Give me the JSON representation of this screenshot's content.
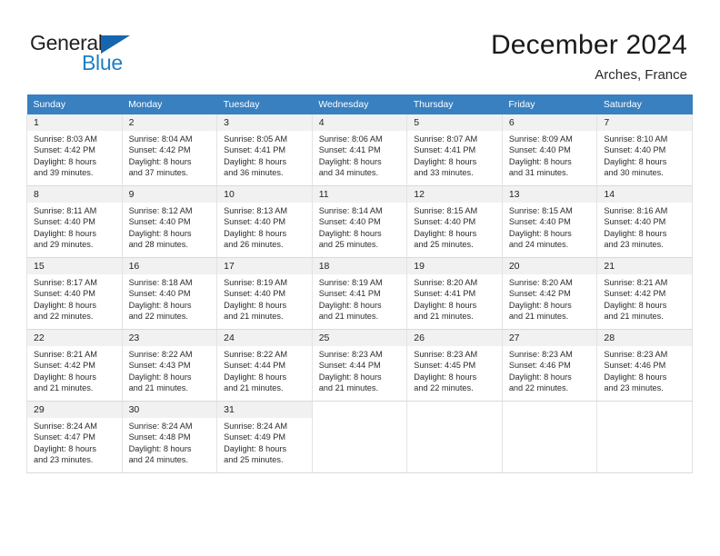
{
  "brand": {
    "name_part1": "General",
    "name_part2": "Blue",
    "triangle_icon": "triangle-icon",
    "color_dark": "#231f20",
    "color_blue": "#1f7ec4"
  },
  "header": {
    "title": "December 2024",
    "location": "Arches, France"
  },
  "theme": {
    "header_row_bg": "#3880c0",
    "daynum_bg": "#f1f1f1",
    "grid_border": "#e3e3e3"
  },
  "weekday_headers": [
    "Sunday",
    "Monday",
    "Tuesday",
    "Wednesday",
    "Thursday",
    "Friday",
    "Saturday"
  ],
  "weeks": [
    [
      {
        "day": "1",
        "sunrise": "Sunrise: 8:03 AM",
        "sunset": "Sunset: 4:42 PM",
        "daylight1": "Daylight: 8 hours",
        "daylight2": "and 39 minutes."
      },
      {
        "day": "2",
        "sunrise": "Sunrise: 8:04 AM",
        "sunset": "Sunset: 4:42 PM",
        "daylight1": "Daylight: 8 hours",
        "daylight2": "and 37 minutes."
      },
      {
        "day": "3",
        "sunrise": "Sunrise: 8:05 AM",
        "sunset": "Sunset: 4:41 PM",
        "daylight1": "Daylight: 8 hours",
        "daylight2": "and 36 minutes."
      },
      {
        "day": "4",
        "sunrise": "Sunrise: 8:06 AM",
        "sunset": "Sunset: 4:41 PM",
        "daylight1": "Daylight: 8 hours",
        "daylight2": "and 34 minutes."
      },
      {
        "day": "5",
        "sunrise": "Sunrise: 8:07 AM",
        "sunset": "Sunset: 4:41 PM",
        "daylight1": "Daylight: 8 hours",
        "daylight2": "and 33 minutes."
      },
      {
        "day": "6",
        "sunrise": "Sunrise: 8:09 AM",
        "sunset": "Sunset: 4:40 PM",
        "daylight1": "Daylight: 8 hours",
        "daylight2": "and 31 minutes."
      },
      {
        "day": "7",
        "sunrise": "Sunrise: 8:10 AM",
        "sunset": "Sunset: 4:40 PM",
        "daylight1": "Daylight: 8 hours",
        "daylight2": "and 30 minutes."
      }
    ],
    [
      {
        "day": "8",
        "sunrise": "Sunrise: 8:11 AM",
        "sunset": "Sunset: 4:40 PM",
        "daylight1": "Daylight: 8 hours",
        "daylight2": "and 29 minutes."
      },
      {
        "day": "9",
        "sunrise": "Sunrise: 8:12 AM",
        "sunset": "Sunset: 4:40 PM",
        "daylight1": "Daylight: 8 hours",
        "daylight2": "and 28 minutes."
      },
      {
        "day": "10",
        "sunrise": "Sunrise: 8:13 AM",
        "sunset": "Sunset: 4:40 PM",
        "daylight1": "Daylight: 8 hours",
        "daylight2": "and 26 minutes."
      },
      {
        "day": "11",
        "sunrise": "Sunrise: 8:14 AM",
        "sunset": "Sunset: 4:40 PM",
        "daylight1": "Daylight: 8 hours",
        "daylight2": "and 25 minutes."
      },
      {
        "day": "12",
        "sunrise": "Sunrise: 8:15 AM",
        "sunset": "Sunset: 4:40 PM",
        "daylight1": "Daylight: 8 hours",
        "daylight2": "and 25 minutes."
      },
      {
        "day": "13",
        "sunrise": "Sunrise: 8:15 AM",
        "sunset": "Sunset: 4:40 PM",
        "daylight1": "Daylight: 8 hours",
        "daylight2": "and 24 minutes."
      },
      {
        "day": "14",
        "sunrise": "Sunrise: 8:16 AM",
        "sunset": "Sunset: 4:40 PM",
        "daylight1": "Daylight: 8 hours",
        "daylight2": "and 23 minutes."
      }
    ],
    [
      {
        "day": "15",
        "sunrise": "Sunrise: 8:17 AM",
        "sunset": "Sunset: 4:40 PM",
        "daylight1": "Daylight: 8 hours",
        "daylight2": "and 22 minutes."
      },
      {
        "day": "16",
        "sunrise": "Sunrise: 8:18 AM",
        "sunset": "Sunset: 4:40 PM",
        "daylight1": "Daylight: 8 hours",
        "daylight2": "and 22 minutes."
      },
      {
        "day": "17",
        "sunrise": "Sunrise: 8:19 AM",
        "sunset": "Sunset: 4:40 PM",
        "daylight1": "Daylight: 8 hours",
        "daylight2": "and 21 minutes."
      },
      {
        "day": "18",
        "sunrise": "Sunrise: 8:19 AM",
        "sunset": "Sunset: 4:41 PM",
        "daylight1": "Daylight: 8 hours",
        "daylight2": "and 21 minutes."
      },
      {
        "day": "19",
        "sunrise": "Sunrise: 8:20 AM",
        "sunset": "Sunset: 4:41 PM",
        "daylight1": "Daylight: 8 hours",
        "daylight2": "and 21 minutes."
      },
      {
        "day": "20",
        "sunrise": "Sunrise: 8:20 AM",
        "sunset": "Sunset: 4:42 PM",
        "daylight1": "Daylight: 8 hours",
        "daylight2": "and 21 minutes."
      },
      {
        "day": "21",
        "sunrise": "Sunrise: 8:21 AM",
        "sunset": "Sunset: 4:42 PM",
        "daylight1": "Daylight: 8 hours",
        "daylight2": "and 21 minutes."
      }
    ],
    [
      {
        "day": "22",
        "sunrise": "Sunrise: 8:21 AM",
        "sunset": "Sunset: 4:42 PM",
        "daylight1": "Daylight: 8 hours",
        "daylight2": "and 21 minutes."
      },
      {
        "day": "23",
        "sunrise": "Sunrise: 8:22 AM",
        "sunset": "Sunset: 4:43 PM",
        "daylight1": "Daylight: 8 hours",
        "daylight2": "and 21 minutes."
      },
      {
        "day": "24",
        "sunrise": "Sunrise: 8:22 AM",
        "sunset": "Sunset: 4:44 PM",
        "daylight1": "Daylight: 8 hours",
        "daylight2": "and 21 minutes."
      },
      {
        "day": "25",
        "sunrise": "Sunrise: 8:23 AM",
        "sunset": "Sunset: 4:44 PM",
        "daylight1": "Daylight: 8 hours",
        "daylight2": "and 21 minutes."
      },
      {
        "day": "26",
        "sunrise": "Sunrise: 8:23 AM",
        "sunset": "Sunset: 4:45 PM",
        "daylight1": "Daylight: 8 hours",
        "daylight2": "and 22 minutes."
      },
      {
        "day": "27",
        "sunrise": "Sunrise: 8:23 AM",
        "sunset": "Sunset: 4:46 PM",
        "daylight1": "Daylight: 8 hours",
        "daylight2": "and 22 minutes."
      },
      {
        "day": "28",
        "sunrise": "Sunrise: 8:23 AM",
        "sunset": "Sunset: 4:46 PM",
        "daylight1": "Daylight: 8 hours",
        "daylight2": "and 23 minutes."
      }
    ],
    [
      {
        "day": "29",
        "sunrise": "Sunrise: 8:24 AM",
        "sunset": "Sunset: 4:47 PM",
        "daylight1": "Daylight: 8 hours",
        "daylight2": "and 23 minutes."
      },
      {
        "day": "30",
        "sunrise": "Sunrise: 8:24 AM",
        "sunset": "Sunset: 4:48 PM",
        "daylight1": "Daylight: 8 hours",
        "daylight2": "and 24 minutes."
      },
      {
        "day": "31",
        "sunrise": "Sunrise: 8:24 AM",
        "sunset": "Sunset: 4:49 PM",
        "daylight1": "Daylight: 8 hours",
        "daylight2": "and 25 minutes."
      },
      {
        "day": "",
        "sunrise": "",
        "sunset": "",
        "daylight1": "",
        "daylight2": ""
      },
      {
        "day": "",
        "sunrise": "",
        "sunset": "",
        "daylight1": "",
        "daylight2": ""
      },
      {
        "day": "",
        "sunrise": "",
        "sunset": "",
        "daylight1": "",
        "daylight2": ""
      },
      {
        "day": "",
        "sunrise": "",
        "sunset": "",
        "daylight1": "",
        "daylight2": ""
      }
    ]
  ]
}
